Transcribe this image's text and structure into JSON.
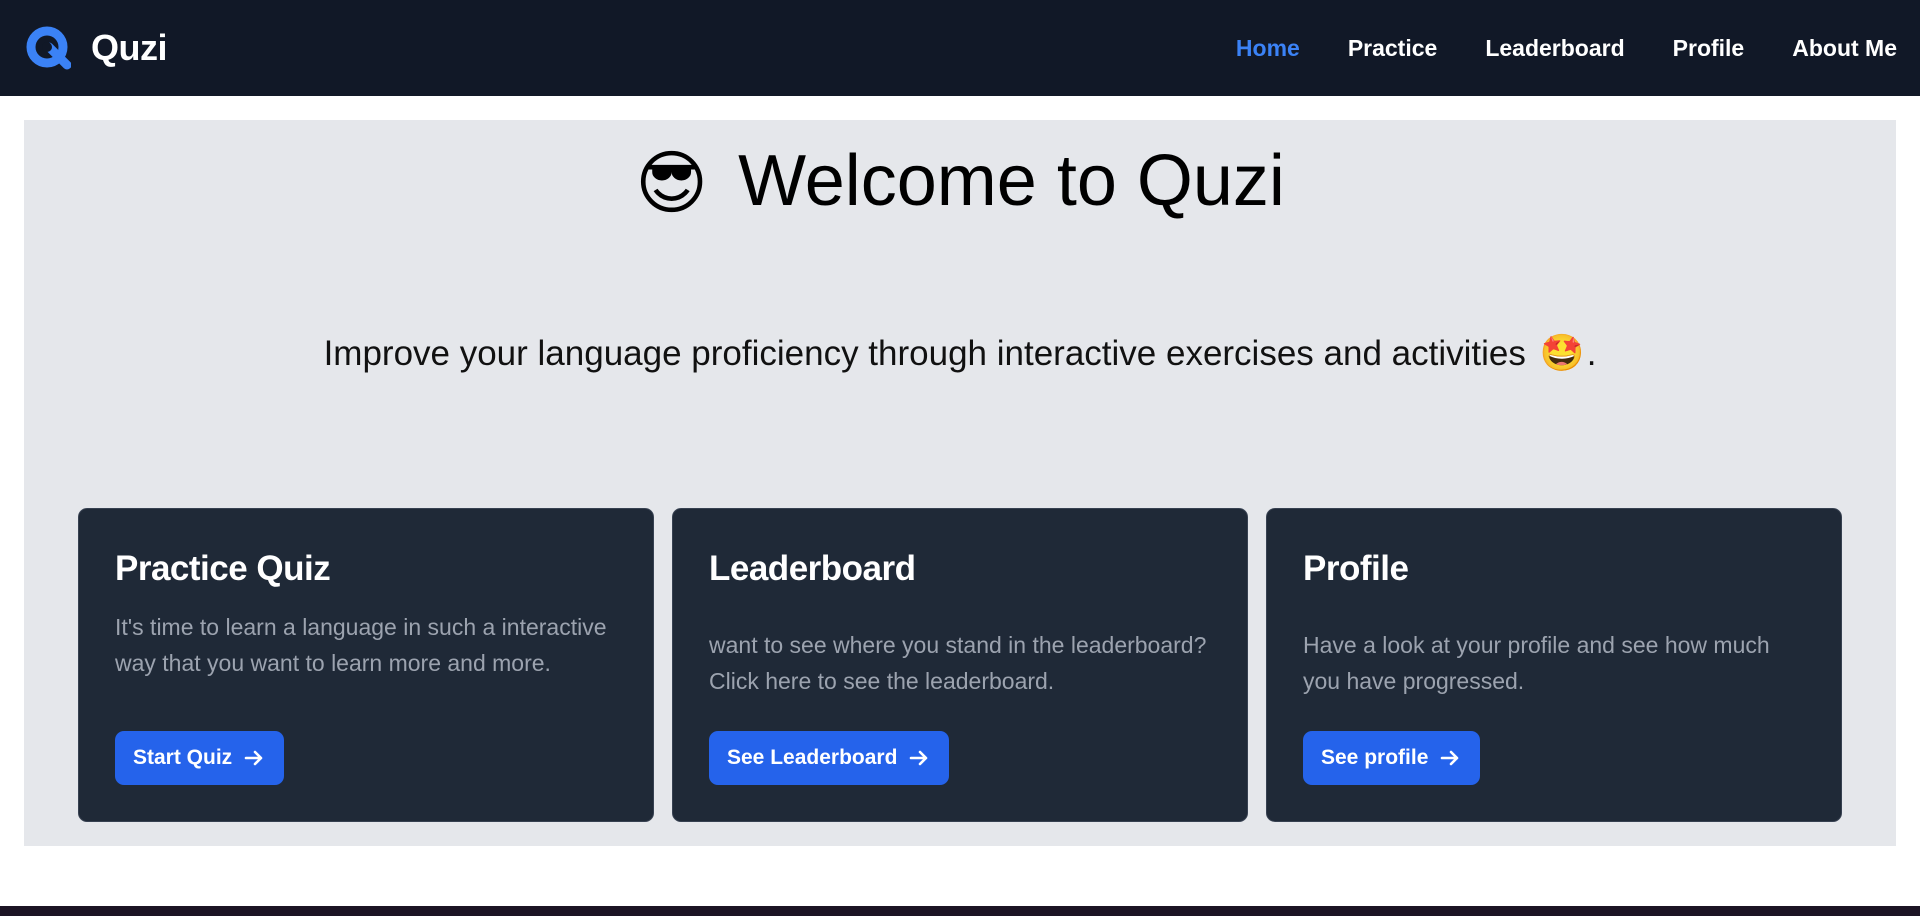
{
  "navbar": {
    "brand": "Quzi",
    "logo_icon": "quzi-logo-icon",
    "links": [
      {
        "label": "Home",
        "active": true
      },
      {
        "label": "Practice",
        "active": false
      },
      {
        "label": "Leaderboard",
        "active": false
      },
      {
        "label": "Profile",
        "active": false
      },
      {
        "label": "About Me",
        "active": false
      }
    ]
  },
  "hero": {
    "title_emoji": "😎",
    "title": "Welcome to Quzi",
    "subtitle": "Improve your language proficiency through interactive exercises and activities",
    "subtitle_emoji": "🤩",
    "subtitle_end": "."
  },
  "cards": [
    {
      "title": "Practice Quiz",
      "description": "It's time to learn a language in such a interactive way that you want to learn more and more.",
      "button": "Start Quiz"
    },
    {
      "title": "Leaderboard",
      "description": "want to see where you stand in the leaderboard? Click here to see the leaderboard.",
      "button": "See Leaderboard"
    },
    {
      "title": "Profile",
      "description": "Have a look at your profile and see how much you have progressed.",
      "button": "See profile"
    }
  ],
  "colors": {
    "navbar_bg": "#111827",
    "accent": "#3b82f6",
    "hero_bg": "#e5e7eb",
    "card_bg": "#1f2937",
    "button_bg": "#2563eb",
    "card_text_muted": "#9ca3af"
  }
}
